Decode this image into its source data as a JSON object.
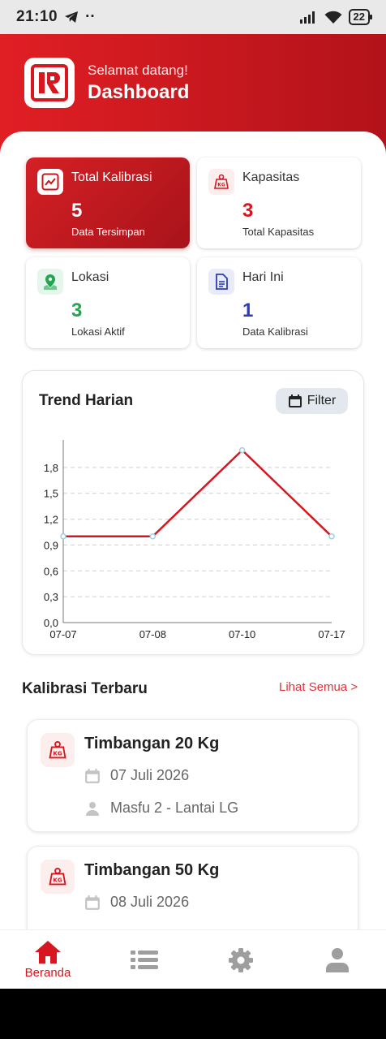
{
  "status_bar": {
    "time": "21:10",
    "extra": "··",
    "battery": "22"
  },
  "header": {
    "welcome": "Selamat datang!",
    "title": "Dashboard"
  },
  "stats": [
    {
      "label": "Total Kalibrasi",
      "value": "5",
      "sub": "Data Tersimpan",
      "icon": "chart-icon",
      "value_color": "#ffffff"
    },
    {
      "label": "Kapasitas",
      "value": "3",
      "sub": "Total Kapasitas",
      "icon": "weight-kg-icon",
      "value_color": "#d8161f"
    },
    {
      "label": "Lokasi",
      "value": "3",
      "sub": "Lokasi Aktif",
      "icon": "map-pin-icon",
      "value_color": "#22a650"
    },
    {
      "label": "Hari Ini",
      "value": "1",
      "sub": "Data Kalibrasi",
      "icon": "document-icon",
      "value_color": "#2c3cb8"
    }
  ],
  "trend": {
    "title": "Trend Harian",
    "filter_label": "Filter"
  },
  "chart_data": {
    "type": "line",
    "categories": [
      "07-07",
      "07-08",
      "07-10",
      "07-17"
    ],
    "values": [
      1,
      1,
      2,
      1
    ],
    "yticks": [
      "0,0",
      "0,3",
      "0,6",
      "0,9",
      "1,2",
      "1,5",
      "1,8"
    ],
    "ylim": [
      0,
      2.1
    ],
    "grid": true,
    "line_color": "#d8161f"
  },
  "recent": {
    "title": "Kalibrasi Terbaru",
    "see_all": "Lihat Semua >",
    "items": [
      {
        "name": "Timbangan 20 Kg",
        "date": "07 Juli 2026",
        "person": "Masfu 2 - Lantai LG"
      },
      {
        "name": "Timbangan 50 Kg",
        "date": "08 Juli 2026"
      }
    ]
  },
  "nav": {
    "home_label": "Beranda",
    "accent": "#d8161f",
    "inactive": "#9e9e9e"
  }
}
